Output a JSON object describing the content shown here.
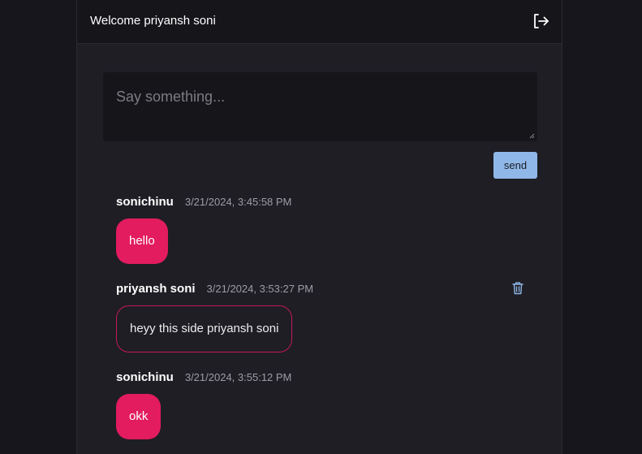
{
  "header": {
    "title": "Welcome priyansh soni",
    "logout_icon": "logout-icon"
  },
  "composer": {
    "placeholder": "Say something...",
    "value": "",
    "send_label": "send"
  },
  "messages": [
    {
      "user": "sonichinu",
      "timestamp": "3/21/2024, 3:45:58 PM",
      "text": "hello",
      "own": false
    },
    {
      "user": "priyansh soni",
      "timestamp": "3/21/2024, 3:53:27 PM",
      "text": "heyy this side priyansh soni",
      "own": true,
      "delete_icon": "trash-icon"
    },
    {
      "user": "sonichinu",
      "timestamp": "3/21/2024, 3:55:12 PM",
      "text": "okk",
      "own": false
    }
  ],
  "colors": {
    "page_bg": "#17161c",
    "panel_bg": "#1f1e25",
    "header_bg": "#16151a",
    "accent_bubble": "#e21c5e",
    "own_bubble_border": "#c21a55",
    "send_button": "#8fb8e8",
    "delete_icon": "#8fb8e8"
  }
}
